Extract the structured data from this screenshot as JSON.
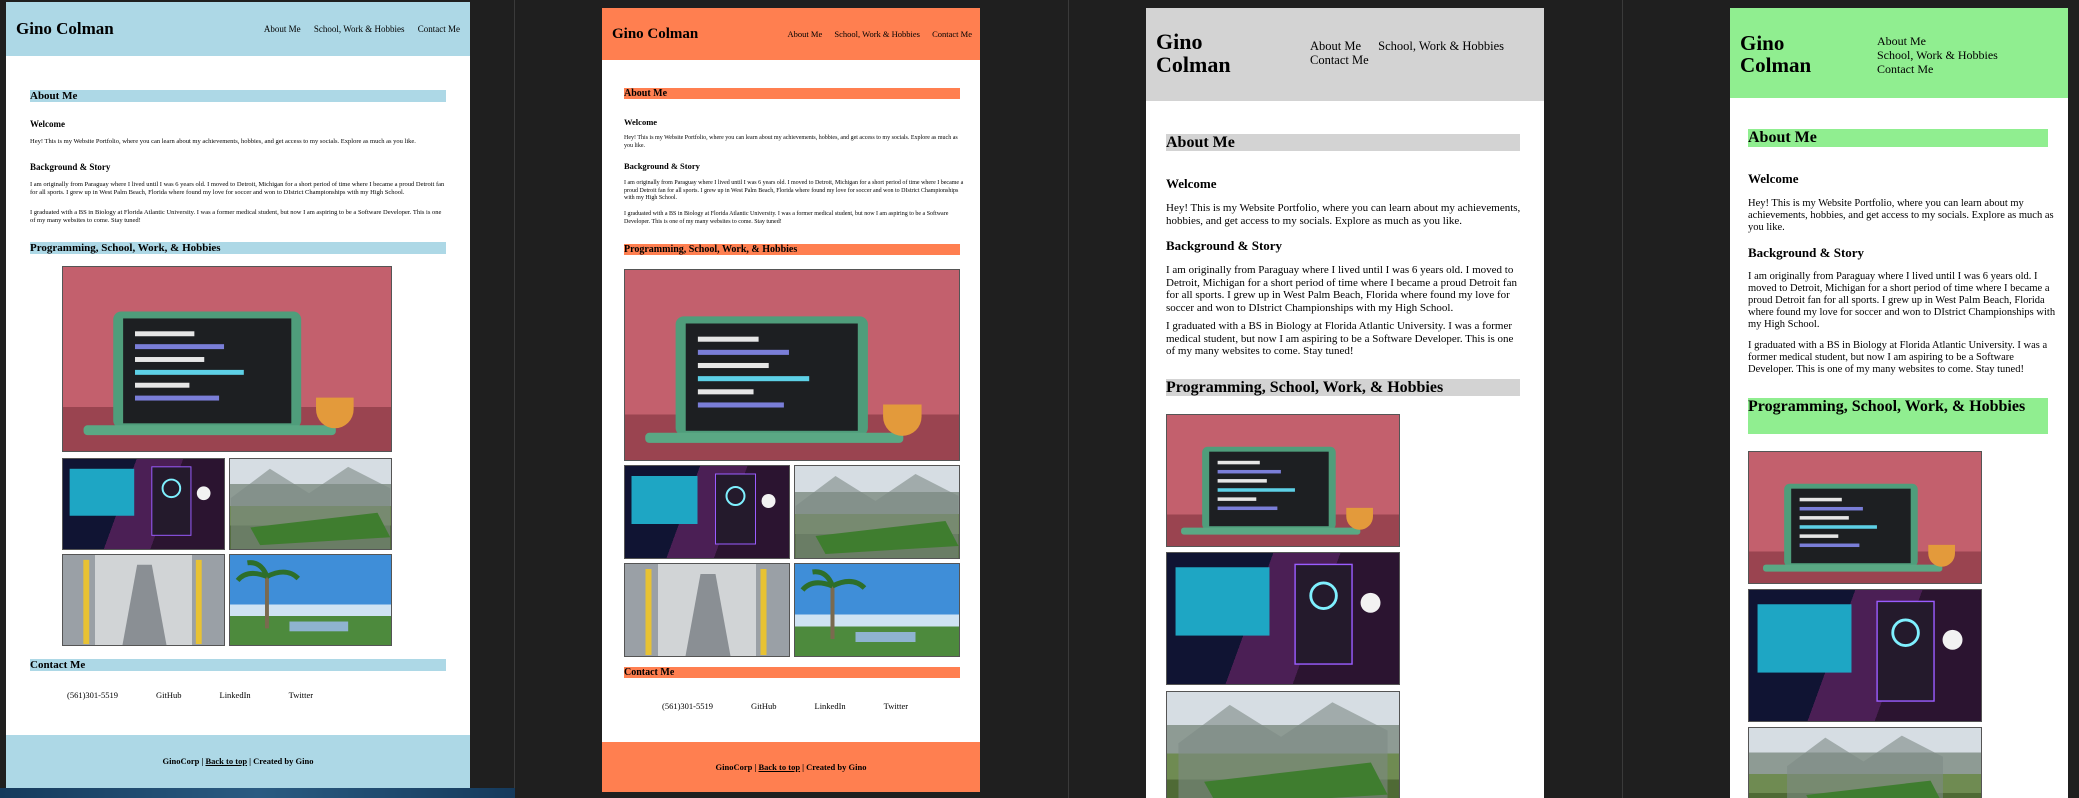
{
  "site": {
    "logo": "Gino Colman",
    "nav": [
      "About Me",
      "School, Work & Hobbies",
      "Contact Me"
    ],
    "about": {
      "heading": "About Me",
      "welcome_heading": "Welcome",
      "welcome_text": "Hey! This is my Website Portfolio, where you can learn about my achievements, hobbies, and get access to my socials. Explore as much as you like.",
      "background_heading": "Background & Story",
      "story_p1": "I am originally from Paraguay where I lived until I was 6 years old. I moved to Detroit, Michigan for a short period of time where I became a proud Detroit fan for all sports. I grew up in West Palm Beach, Florida where found my love for soccer and won to DIstrict Championships with my High School.",
      "story_p2": "I graduated with a BS in Biology at Florida Atlantic University. I was a former medical student, but now I am aspiring to be a Software Developer. This is one of my many websites to come. Stay tuned!"
    },
    "programming_heading": "Programming, School, Work, & Hobbies",
    "images": [
      {
        "name": "laptop-illustration",
        "icon": "laptop-icon"
      },
      {
        "name": "gaming-setup-photo",
        "icon": "monitor-icon"
      },
      {
        "name": "soccer-field-photo",
        "icon": "mountain-icon"
      },
      {
        "name": "warehouse-photo",
        "icon": "conveyor-icon"
      },
      {
        "name": "palm-trees-photo",
        "icon": "palm-tree-icon"
      }
    ],
    "contact": {
      "heading": "Contact Me",
      "phone": "(561)301-5519",
      "github": "GitHub",
      "linkedin": "LinkedIn",
      "twitter": "Twitter"
    },
    "footer": {
      "company": "GinoCorp",
      "sep1": " | ",
      "back_to_top": "Back to top",
      "sep2": " | ",
      "created_by": "Created by Gino"
    }
  },
  "themes": {
    "blue": "#add8e6",
    "coral": "#ff7f50",
    "grey": "#d3d3d3",
    "green": "#90ee90"
  }
}
